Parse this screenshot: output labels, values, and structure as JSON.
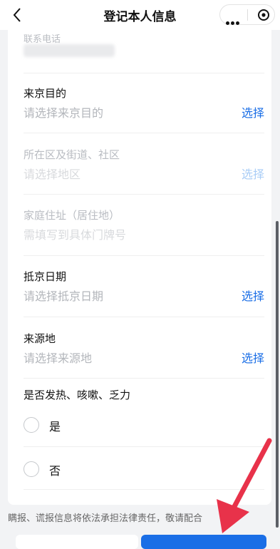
{
  "header": {
    "title": "登记本人信息"
  },
  "form": {
    "phone_label": "联系电话",
    "purpose": {
      "label": "来京目的",
      "placeholder": "请选择来京目的",
      "action": "选择"
    },
    "district": {
      "label": "所在区及街道、社区",
      "placeholder": "请选择地区",
      "action": "选择"
    },
    "address": {
      "label": "家庭住址（居住地）",
      "placeholder": "需填写到具体门牌号"
    },
    "arrival_date": {
      "label": "抵京日期",
      "placeholder": "请选择抵京日期",
      "action": "选择"
    },
    "origin": {
      "label": "来源地",
      "placeholder": "请选择来源地",
      "action": "选择"
    },
    "symptoms": {
      "question": "是否发热、咳嗽、乏力",
      "options": [
        "是",
        "否"
      ]
    }
  },
  "footer": {
    "notice": "瞒报、谎报信息将依法承担法律责任，敬请配合"
  },
  "colors": {
    "accent": "#1a6ee6",
    "arrow": "#e8324a"
  },
  "icons": [
    "back-chevron-icon",
    "more-dots-icon",
    "target-circle-icon",
    "red-arrow-icon"
  ]
}
